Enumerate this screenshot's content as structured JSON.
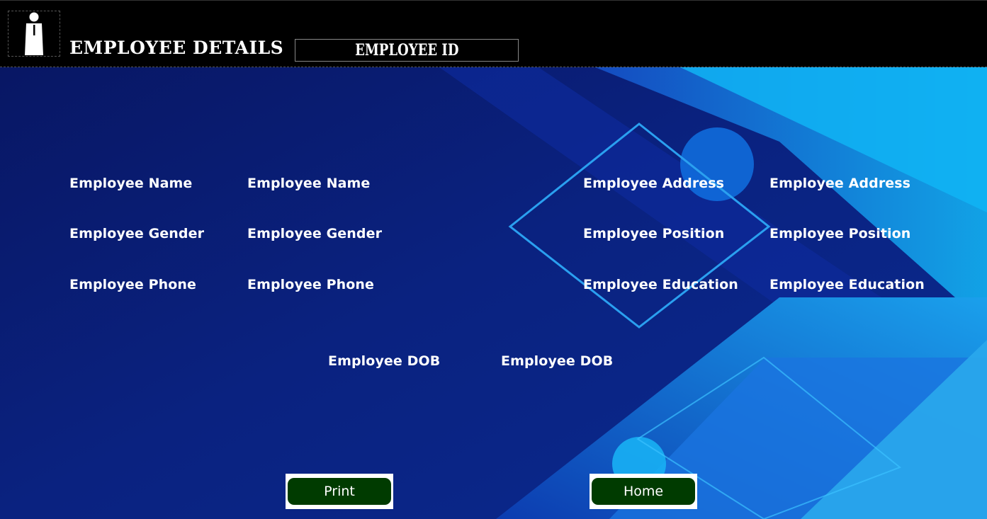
{
  "header": {
    "title": "EMPLOYEE DETAILS",
    "id_label": "EMPLOYEE ID",
    "logo_icon": "employee-person-icon"
  },
  "fields": {
    "name_label": "Employee Name",
    "name_value": "Employee Name",
    "gender_label": "Employee Gender",
    "gender_value": "Employee Gender",
    "phone_label": "Employee Phone",
    "phone_value": "Employee Phone",
    "address_label": "Employee Address",
    "address_value": "Employee Address",
    "position_label": "Employee Position",
    "position_value": "Employee Position",
    "education_label": "Employee Education",
    "education_value": "Employee Education",
    "dob_label": "Employee DOB",
    "dob_value": "Employee DOB"
  },
  "buttons": {
    "print_label": "Print",
    "home_label": "Home"
  },
  "colors": {
    "header_bg": "#000000",
    "background": "#0a1a6e",
    "button_bg": "#003b00",
    "text": "#ffffff"
  }
}
